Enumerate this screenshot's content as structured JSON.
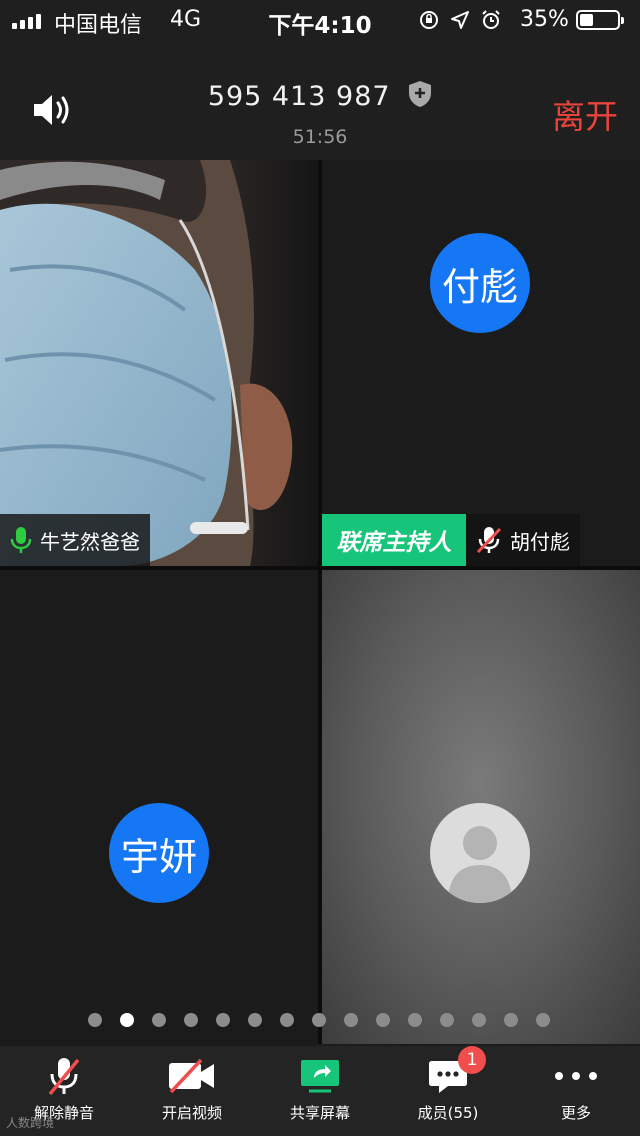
{
  "status_bar": {
    "carrier": "中国电信",
    "network": "4G",
    "time": "下午4:10",
    "battery": "35%"
  },
  "header": {
    "meeting_id": "595 413 987",
    "duration": "51:56",
    "leave_label": "离开"
  },
  "participants": [
    {
      "name": "牛艺然爸爸",
      "mic": "on"
    },
    {
      "avatar_text": "付彪",
      "role_badge": "联席主持人",
      "name": "胡付彪",
      "mic": "muted"
    },
    {
      "avatar_text": "宇妍"
    },
    {
      "avatar": "default-person-avatar"
    }
  ],
  "pagination": {
    "total": 15,
    "active_index": 2
  },
  "toolbar": {
    "unmute_label": "解除静音",
    "video_label": "开启视频",
    "share_label": "共享屏幕",
    "members_label": "成员(55)",
    "members_badge": "1",
    "more_label": "更多"
  },
  "watermark": "人数跨境",
  "colors": {
    "leave": "#e8443b",
    "avatar_blue": "#1677f5",
    "cohost_green": "#16c47a",
    "badge_red": "#f04d4d",
    "mic_green": "#2ecc40"
  }
}
